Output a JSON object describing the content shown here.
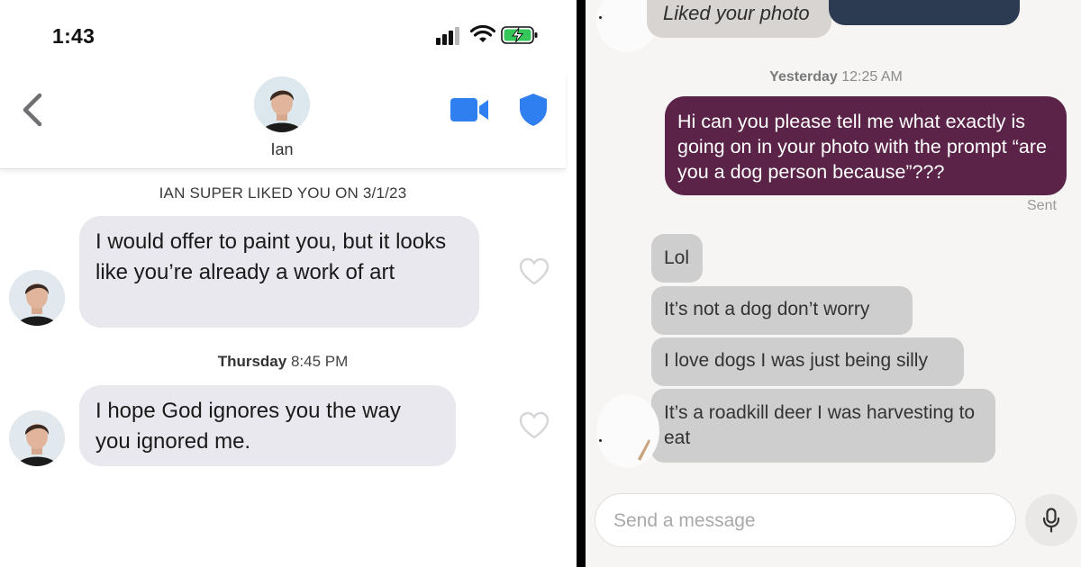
{
  "left": {
    "status": {
      "time": "1:43"
    },
    "header": {
      "name": "Ian"
    },
    "super_like_banner": "IAN SUPER LIKED YOU ON 3/1/23",
    "messages": [
      {
        "text": "I would offer to paint you, but it looks like you’re already a work of art"
      },
      {
        "text": "I hope God ignores you the way you ignored me."
      }
    ],
    "timestamp": {
      "day": "Thursday",
      "time": "8:45 PM"
    }
  },
  "right": {
    "liked_label": "Liked your photo",
    "timestamp": {
      "day": "Yesterday",
      "time": "12:25 AM"
    },
    "sent_message": "Hi can you please tell me what exactly is going on in your photo with the prompt “are you a dog person because”???",
    "sent_status": "Sent",
    "replies": [
      "Lol",
      "It’s not a dog don’t worry",
      "I love dogs I was just being silly",
      "It’s a roadkill deer I was harvesting to eat"
    ],
    "composer_placeholder": "Send a message"
  },
  "colors": {
    "accent_blue": "#2f7ff0",
    "sent_bubble": "#5a2347",
    "received_bubble_left": "#e8e8ee",
    "received_bubble_right": "#cfcece",
    "battery_green": "#35c759"
  },
  "icons": [
    "back-chevron-icon",
    "video-camera-icon",
    "shield-icon",
    "heart-icon",
    "microphone-icon",
    "signal-icon",
    "wifi-icon",
    "battery-charging-icon"
  ]
}
